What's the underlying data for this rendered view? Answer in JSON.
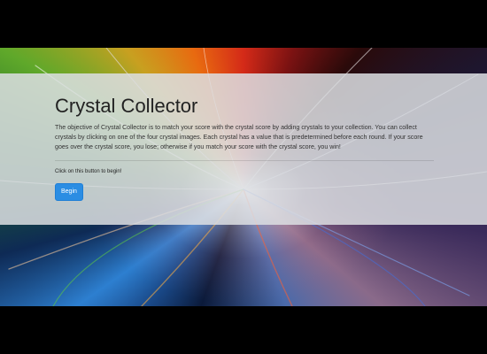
{
  "jumbotron": {
    "title": "Crystal Collector",
    "description": "The objective of Crystal Collector is to match your score with the crystal score by adding crystals to your collection. You can collect crystals by clicking on one of the four crystal images. Each crystal has a value that is predetermined before each round. If your score goes over the crystal score, you lose; otherwise if you match your score with the crystal score, you win!",
    "prompt": "Click on this button to begin!",
    "begin_button_label": "Begin"
  },
  "colors": {
    "page_background": "#000000",
    "panel_background": "#dcdee2",
    "button_primary": "#2b8de3"
  }
}
